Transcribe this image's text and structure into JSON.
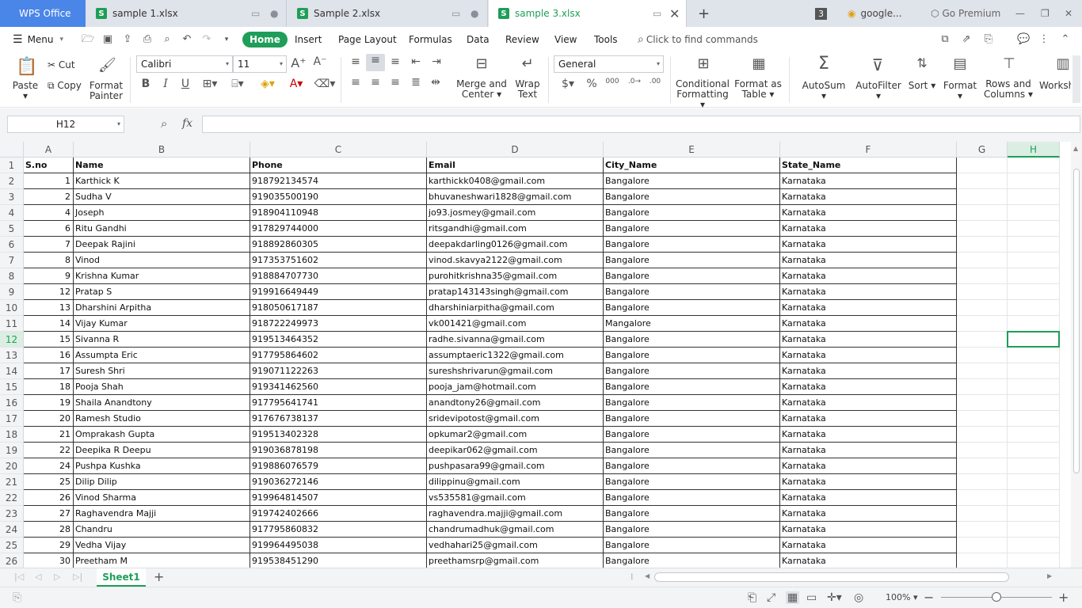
{
  "titlebar": {
    "app_tab": "WPS Office",
    "tabs": [
      {
        "label": "sample 1.xlsx"
      },
      {
        "label": "Sample 2.xlsx"
      },
      {
        "label": "sample 3.xlsx"
      }
    ],
    "window_count": "3",
    "browser_tab": "google...",
    "premium": "Go Premium"
  },
  "menubar": {
    "menu": "Menu",
    "items": [
      "Home",
      "Insert",
      "Page Layout",
      "Formulas",
      "Data",
      "Review",
      "View",
      "Tools"
    ],
    "search": "Click to find commands"
  },
  "ribbon": {
    "paste": "Paste",
    "cut": "Cut",
    "copy": "Copy",
    "format_painter_1": "Format",
    "format_painter_2": "Painter",
    "font_name": "Calibri",
    "font_size": "11",
    "merge_1": "Merge and",
    "merge_2": "Center",
    "wrap_1": "Wrap",
    "wrap_2": "Text",
    "number_format": "General",
    "cond_1": "Conditional",
    "cond_2": "Formatting",
    "fmt_table_1": "Format as",
    "fmt_table_2": "Table",
    "autosum": "AutoSum",
    "autofilter": "AutoFilter",
    "sort": "Sort",
    "format": "Format",
    "rows_cols_1": "Rows and",
    "rows_cols_2": "Columns",
    "worksheet": "Worksh"
  },
  "formula_bar": {
    "name_box": "H12",
    "fx": "fx",
    "value": ""
  },
  "columns": [
    "A",
    "B",
    "C",
    "D",
    "E",
    "F",
    "G",
    "H"
  ],
  "selected_column": "H",
  "selected_row": "12",
  "headers": [
    "S.no",
    "Name",
    "Phone",
    "Email",
    "City_Name",
    "State_Name"
  ],
  "rows": [
    [
      "1",
      "Karthick K",
      "918792134574",
      "karthickk0408@gmail.com",
      "Bangalore",
      "Karnataka"
    ],
    [
      "2",
      "Sudha V",
      "919035500190",
      "bhuvaneshwari1828@gmail.com",
      "Bangalore",
      "Karnataka"
    ],
    [
      "4",
      "Joseph",
      "918904110948",
      "jo93.josmey@gmail.com",
      "Bangalore",
      "Karnataka"
    ],
    [
      "6",
      "Ritu Gandhi",
      "917829744000",
      "ritsgandhi@gmail.com",
      "Bangalore",
      "Karnataka"
    ],
    [
      "7",
      "Deepak Rajini",
      "918892860305",
      "deepakdarling0126@gmail.com",
      "Bangalore",
      "Karnataka"
    ],
    [
      "8",
      "Vinod",
      "917353751602",
      "vinod.skavya2122@gmail.com",
      "Bangalore",
      "Karnataka"
    ],
    [
      "9",
      "Krishna Kumar",
      "918884707730",
      "purohitkrishna35@gmail.com",
      "Bangalore",
      "Karnataka"
    ],
    [
      "12",
      "Pratap S",
      "919916649449",
      "pratap143143singh@gmail.com",
      "Bangalore",
      "Karnataka"
    ],
    [
      "13",
      "Dharshini Arpitha",
      "918050617187",
      "dharshiniarpitha@gmail.com",
      "Bangalore",
      "Karnataka"
    ],
    [
      "14",
      "Vijay Kumar",
      "918722249973",
      "vk001421@gmail.com",
      "Mangalore",
      "Karnataka"
    ],
    [
      "15",
      "Sivanna R",
      "919513464352",
      "radhe.sivanna@gmail.com",
      "Bangalore",
      "Karnataka"
    ],
    [
      "16",
      "Assumpta Eric",
      "917795864602",
      "assumptaeric1322@gmail.com",
      "Bangalore",
      "Karnataka"
    ],
    [
      "17",
      "Suresh Shri",
      "919071122263",
      "sureshshrivarun@gmail.com",
      "Bangalore",
      "Karnataka"
    ],
    [
      "18",
      "Pooja Shah",
      "919341462560",
      "pooja_jam@hotmail.com",
      "Bangalore",
      "Karnataka"
    ],
    [
      "19",
      "Shaila Anandtony",
      "917795641741",
      "anandtony26@gmail.com",
      "Bangalore",
      "Karnataka"
    ],
    [
      "20",
      "Ramesh Studio",
      "917676738137",
      "sridevipotost@gmail.com",
      "Bangalore",
      "Karnataka"
    ],
    [
      "21",
      "Omprakash Gupta",
      "919513402328",
      "opkumar2@gmail.com",
      "Bangalore",
      "Karnataka"
    ],
    [
      "22",
      "Deepika  R Deepu",
      "919036878198",
      "deepikar062@gmail.com",
      "Bangalore",
      "Karnataka"
    ],
    [
      "24",
      "Pushpa Kushka",
      "919886076579",
      "pushpasara99@gmail.com",
      "Bangalore",
      "Karnataka"
    ],
    [
      "25",
      "Dilip Dilip",
      "919036272146",
      "dilippinu@gmail.com",
      "Bangalore",
      "Karnataka"
    ],
    [
      "26",
      "Vinod Sharma",
      "919964814507",
      "vs535581@gmail.com",
      "Bangalore",
      "Karnataka"
    ],
    [
      "27",
      "Raghavendra Majji",
      "919742402666",
      "raghavendra.majji@gmail.com",
      "Bangalore",
      "Karnataka"
    ],
    [
      "28",
      "Chandru",
      "917795860832",
      "chandrumadhuk@gmail.com",
      "Bangalore",
      "Karnataka"
    ],
    [
      "29",
      "Vedha Vijay",
      "919964495038",
      "vedhahari25@gmail.com",
      "Bangalore",
      "Karnataka"
    ],
    [
      "30",
      "Preetham M",
      "919538451290",
      "preethamsrp@gmail.com",
      "Bangalore",
      "Karnataka"
    ]
  ],
  "sheet": {
    "tab": "Sheet1"
  },
  "status": {
    "zoom": "100%"
  },
  "colors": {
    "accent": "#1e9e58",
    "wps_blue": "#4a86e8"
  }
}
